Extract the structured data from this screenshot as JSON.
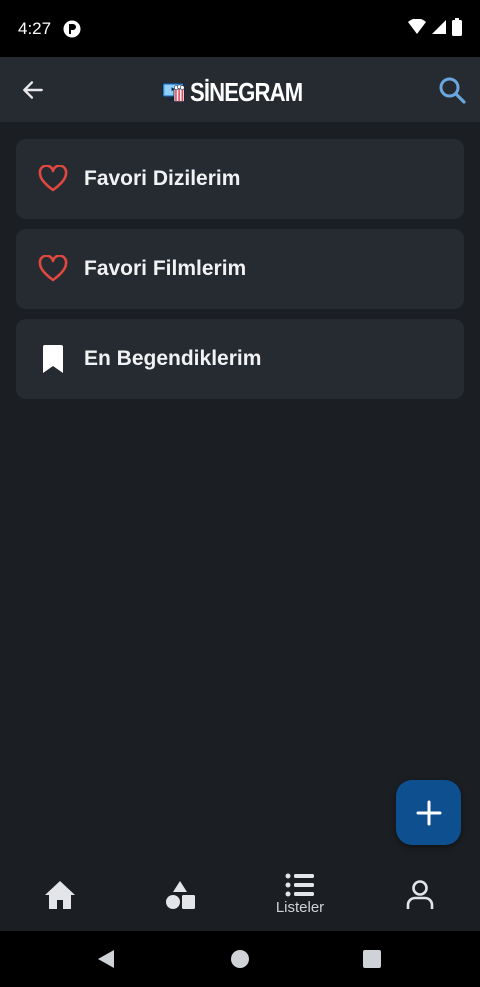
{
  "status_bar": {
    "time": "4:27"
  },
  "app_bar": {
    "title": "SİNEGRAM"
  },
  "lists": [
    {
      "label": "Favori Dizilerim",
      "icon": "heart-outline-icon"
    },
    {
      "label": "Favori Filmlerim",
      "icon": "heart-outline-icon"
    },
    {
      "label": "En Begendiklerim",
      "icon": "bookmark-icon"
    }
  ],
  "bottom_nav": {
    "items": [
      {
        "label": "",
        "icon": "home-icon"
      },
      {
        "label": "",
        "icon": "shapes-icon"
      },
      {
        "label": "Listeler",
        "icon": "list-icon",
        "active": true
      },
      {
        "label": "",
        "icon": "profile-icon"
      }
    ]
  },
  "colors": {
    "background": "#1b1e22",
    "card": "#262b31",
    "accent": "#0d4f8f",
    "heart": "#e0483f",
    "search": "#6aa7e0"
  }
}
